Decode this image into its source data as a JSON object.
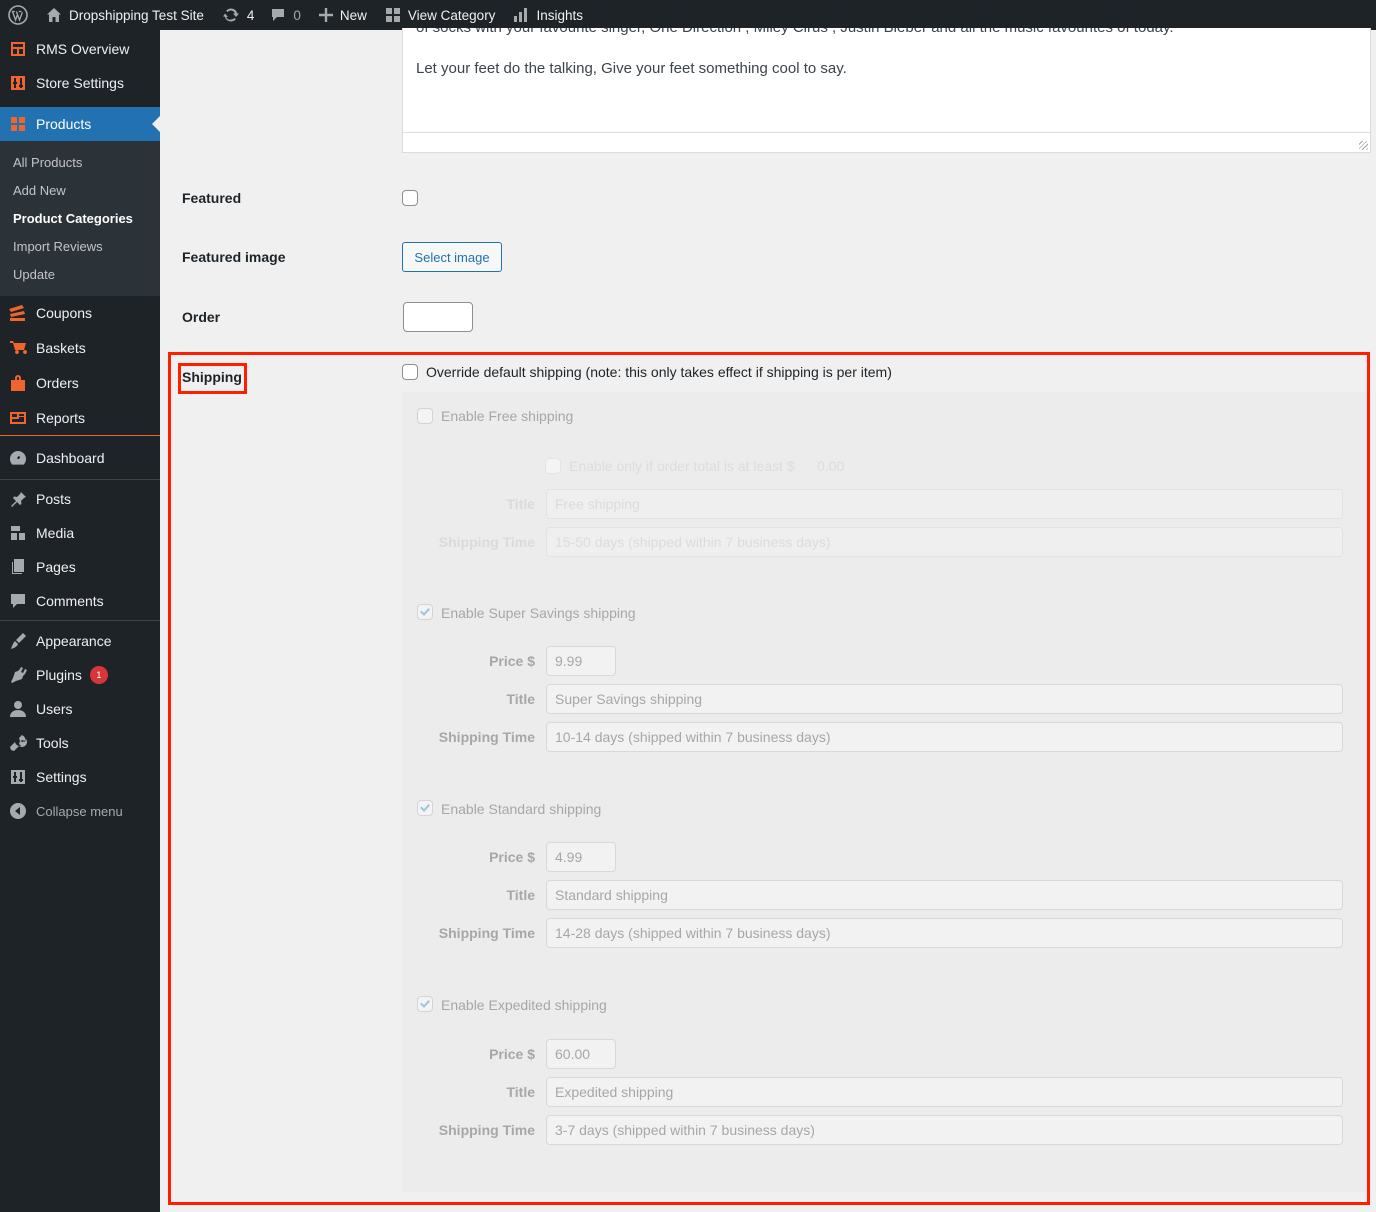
{
  "adminbar": {
    "site_name": "Dropshipping Test Site",
    "updates_count": "4",
    "comments_count": "0",
    "new_label": "New",
    "view_category_label": "View Category",
    "insights_label": "Insights"
  },
  "sidebar": {
    "items": [
      {
        "label": "RMS Overview",
        "icon": "rms-overview-icon"
      },
      {
        "label": "Store Settings",
        "icon": "store-settings-icon"
      },
      {
        "label": "Products",
        "icon": "products-icon"
      },
      {
        "label": "Coupons",
        "icon": "coupons-icon"
      },
      {
        "label": "Baskets",
        "icon": "baskets-icon"
      },
      {
        "label": "Orders",
        "icon": "orders-icon"
      },
      {
        "label": "Reports",
        "icon": "reports-icon"
      },
      {
        "label": "Dashboard",
        "icon": "dashboard-icon"
      },
      {
        "label": "Posts",
        "icon": "posts-icon"
      },
      {
        "label": "Media",
        "icon": "media-icon"
      },
      {
        "label": "Pages",
        "icon": "pages-icon"
      },
      {
        "label": "Comments",
        "icon": "comments-icon"
      },
      {
        "label": "Appearance",
        "icon": "appearance-icon"
      },
      {
        "label": "Plugins",
        "icon": "plugins-icon",
        "badge": "1"
      },
      {
        "label": "Users",
        "icon": "users-icon"
      },
      {
        "label": "Tools",
        "icon": "tools-icon"
      },
      {
        "label": "Settings",
        "icon": "settings-icon"
      }
    ],
    "submenu": [
      "All Products",
      "Add New",
      "Product Categories",
      "Import Reviews",
      "Update"
    ],
    "collapse_label": "Collapse menu"
  },
  "editor": {
    "line1": "of socks with your favourite singer, One Direction , Miley Cirus , Justin Bieber and all the music favourites of today.",
    "line2": "Let your feet do the talking, Give your feet something cool to say."
  },
  "form": {
    "featured_label": "Featured",
    "featured_image_label": "Featured image",
    "select_image_label": "Select image",
    "order_label": "Order",
    "shipping_label": "Shipping",
    "override_label": "Override default shipping (note: this only takes effect if shipping is per item)"
  },
  "shipping": {
    "free": {
      "enable_label": "Enable Free shipping",
      "min_total_label": "Enable only if order total is at least $",
      "min_total_value": "0.00",
      "title_label": "Title",
      "title_value": "Free shipping",
      "time_label": "Shipping Time",
      "time_value": "15-50 days (shipped within 7 business days)"
    },
    "methods": [
      {
        "enable_label": "Enable Super Savings shipping",
        "price_label": "Price $",
        "price": "9.99",
        "title_label": "Title",
        "title": "Super Savings shipping",
        "time_label": "Shipping Time",
        "time": "10-14 days (shipped within 7 business days)"
      },
      {
        "enable_label": "Enable Standard shipping",
        "price_label": "Price $",
        "price": "4.99",
        "title_label": "Title",
        "title": "Standard shipping",
        "time_label": "Shipping Time",
        "time": "14-28 days (shipped within 7 business days)"
      },
      {
        "enable_label": "Enable Expedited shipping",
        "price_label": "Price $",
        "price": "60.00",
        "title_label": "Title",
        "title": "Expedited shipping",
        "time_label": "Shipping Time",
        "time": "3-7 days (shipped within 7 business days)"
      }
    ]
  },
  "colors": {
    "admin_dark": "#1d2327",
    "accent_blue": "#2271b1",
    "brand_orange": "#f0642d",
    "highlight_red": "#ff1f00"
  }
}
